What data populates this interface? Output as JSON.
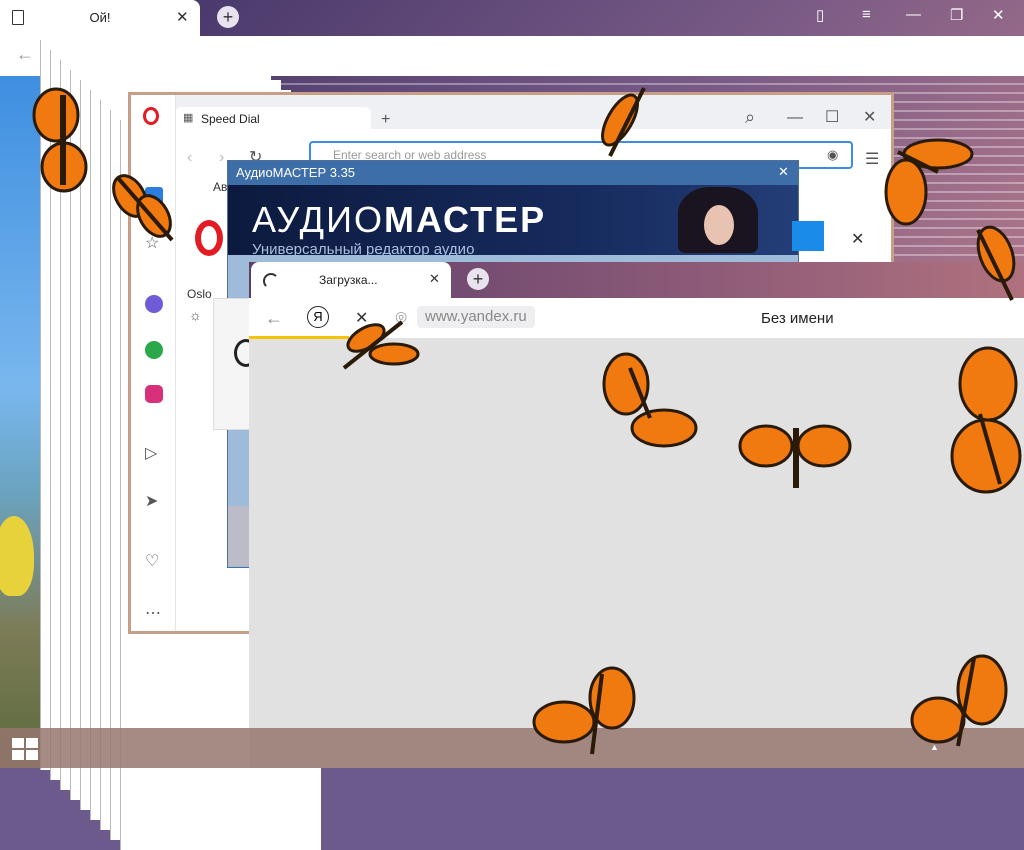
{
  "back_window": {
    "tab_title": "Ой!",
    "new_tab": "+",
    "controls": {
      "bookmarks": "▯",
      "menu": "≡",
      "minimize": "—",
      "restore": "❐",
      "close": "✕"
    }
  },
  "opera": {
    "tab_label": "Speed Dial",
    "new_tab": "+",
    "address_placeholder": "Enter search or web address",
    "city": "Oslo",
    "search_icon": "⌕",
    "minimize": "—",
    "maximize": "☐",
    "close": "✕",
    "partial_label": "Ав"
  },
  "audiomaster": {
    "title": "АудиоМАСТЕР 3.35",
    "logo_light": "АУДИО",
    "logo_bold": "МАСТЕР",
    "subtitle": "Универсальный редактор аудио",
    "close": "✕"
  },
  "yandex": {
    "tab_title": "Загрузка...",
    "tab_close": "✕",
    "new_tab": "+",
    "yandex_logo": "Я",
    "stop": "✕",
    "url": "www.yandex.ru",
    "page_title": "Без имени"
  },
  "taskbar": {
    "start_icon": "windows-logo",
    "tray_arrow": "▲"
  },
  "colors": {
    "yandex_accent": "#f5c400",
    "opera_red": "#e31b23",
    "audiomaster_blue": "#3d6ea8"
  }
}
